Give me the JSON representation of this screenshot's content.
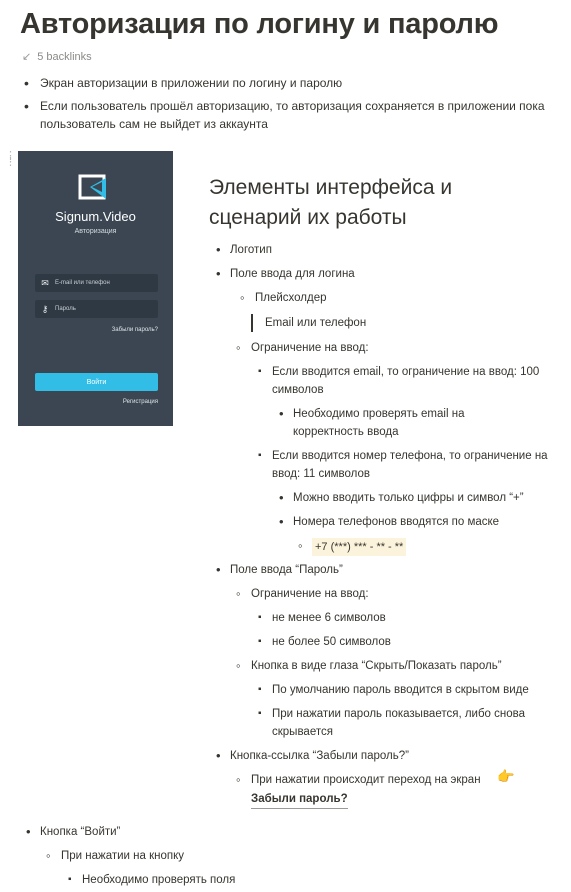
{
  "page": {
    "title": "Авторизация по логину и паролю",
    "backlinks": "5 backlinks"
  },
  "intro": [
    "Экран авторизации в приложении по логину и паролю",
    "Если пользователь прошёл авторизацию, то авторизация сохраняется в приложении пока пользователь сам не выйдет из аккаунта"
  ],
  "mockup": {
    "brand": "Signum.Video",
    "subtitle": "Авторизация",
    "login_placeholder": "E-mail или телефон",
    "password_placeholder": "Пароль",
    "forgot": "Забыли пароль?",
    "login_button": "Войти",
    "register": "Регистрация",
    "accent_color": "#31bde6",
    "background_color": "#3b4652"
  },
  "section": {
    "heading": "Элементы интерфейса и сценарий их работы",
    "logo": "Логотип",
    "login_field": "Поле ввода для логина",
    "placeholder_label": "Плейсхолдер",
    "placeholder_value": "Email или телефон",
    "input_limit": "Ограничение на ввод:",
    "email_limit": "Если вводится email, то ограничение на ввод: 100 символов",
    "email_check": "Необходимо проверять email на корректность ввода",
    "phone_limit": "Если вводится номер телефона, то ограничение на ввод: 11 символов",
    "phone_digits": "Можно вводить только цифры и символ “+”",
    "phone_mask_rule": "Номера телефонов вводятся по маске",
    "phone_mask": "+7 (***) *** - ** - **",
    "password_field": "Поле ввода “Пароль”",
    "password_limit": "Ограничение на ввод:",
    "password_min": "не менее 6 символов",
    "password_max": "не более 50 символов",
    "eye_button": "Кнопка в виде глаза “Скрыть/Показать пароль”",
    "eye_default": "По умолчанию пароль вводится в скрытом виде",
    "eye_click": "При нажатии пароль показывается, либо снова скрывается",
    "forgot_link": "Кнопка-ссылка “Забыли пароль?”",
    "forgot_click": "При нажатии происходит переход на экран",
    "forgot_page": "Забыли пароль?"
  },
  "bottom": {
    "login_button": "Кнопка “Войти”",
    "on_click": "При нажатии на кнопку",
    "check_fields": "Необходимо проверять поля"
  }
}
